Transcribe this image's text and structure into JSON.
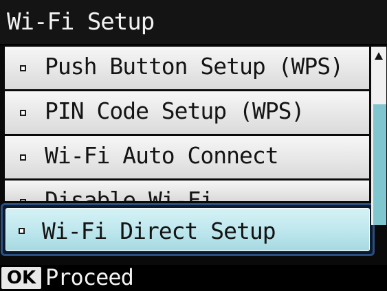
{
  "header": {
    "title": "Wi-Fi Setup"
  },
  "menu": {
    "items": [
      {
        "label": "Push Button Setup (WPS)"
      },
      {
        "label": "PIN Code Setup (WPS)"
      },
      {
        "label": "Wi-Fi Auto Connect"
      },
      {
        "label": "Disable Wi-Fi"
      },
      {
        "label": "Wi-Fi Direct Setup",
        "selected": true
      }
    ],
    "bullet_icon": "square-bullet-icon"
  },
  "scrollbar": {
    "up_icon": "triangle-up-icon"
  },
  "footer": {
    "key_label": "OK",
    "action_label": "Proceed"
  },
  "colors": {
    "selection_fill": "#bfe8ee",
    "selection_border": "#2a4f82",
    "scroll_thumb": "#7fc6cf"
  }
}
